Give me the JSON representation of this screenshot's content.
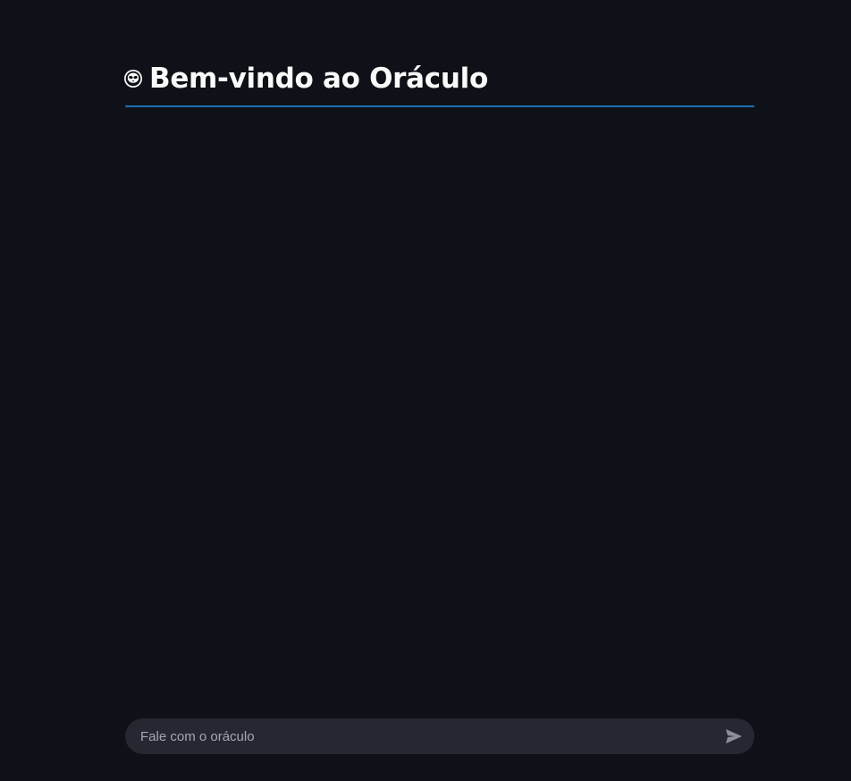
{
  "header": {
    "icon": "alien-face-icon",
    "title": "Bem-vindo ao Oráculo"
  },
  "chat_input": {
    "placeholder": "Fale com o oráculo",
    "value": "",
    "send_icon": "send-icon"
  },
  "colors": {
    "background": "#0e1117",
    "divider": "#1f6fb8",
    "input_background": "#262730",
    "text": "#fafafa",
    "placeholder": "#a3a8b4"
  }
}
